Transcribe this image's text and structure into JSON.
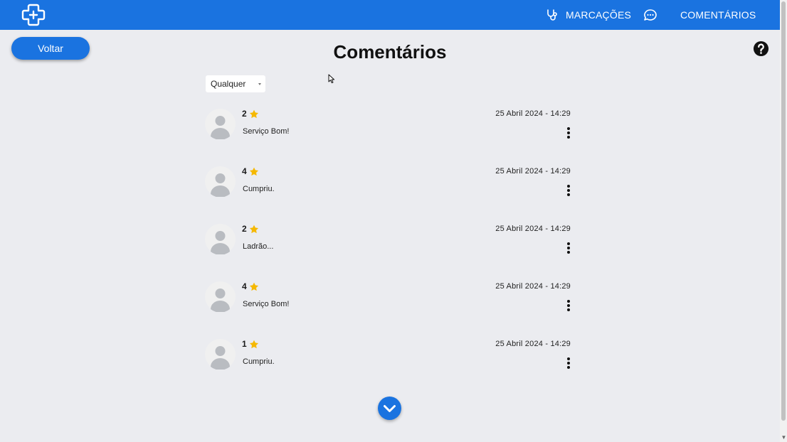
{
  "nav": {
    "logo_icon": "medical-cross-icon",
    "marcacoes_label": "MARCAÇÕES",
    "marcacoes_icon": "stethoscope-icon",
    "chat_icon": "chat-bubble-icon",
    "comentarios_label": "COMENTÁRIOS"
  },
  "page": {
    "back_label": "Voltar",
    "title": "Comentários",
    "help_icon": "question-circle-icon"
  },
  "filter": {
    "selected": "Qualquer"
  },
  "comments": [
    {
      "rating": "2",
      "text": "Serviço Bom!",
      "date": "25 Abril 2024 - 14:29"
    },
    {
      "rating": "4",
      "text": "Cumpriu.",
      "date": "25 Abril 2024 - 14:29"
    },
    {
      "rating": "2",
      "text": "Ladrão...",
      "date": "25 Abril 2024 - 14:29"
    },
    {
      "rating": "4",
      "text": "Serviço Bom!",
      "date": "25 Abril 2024 - 14:29"
    },
    {
      "rating": "1",
      "text": "Cumpriu.",
      "date": "25 Abril 2024 - 14:29"
    }
  ],
  "colors": {
    "primary": "#1a73e0",
    "background": "#ebecf0",
    "star": "#f5b800"
  }
}
